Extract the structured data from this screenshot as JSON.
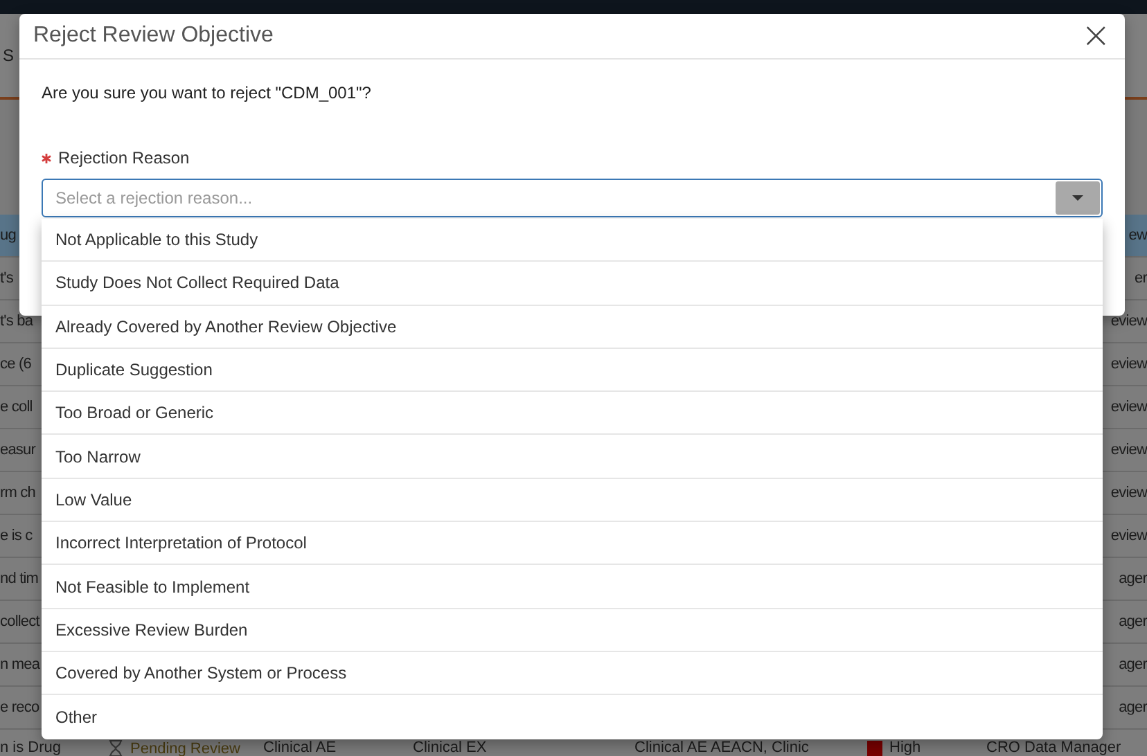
{
  "background": {
    "tab": "S",
    "rows": [
      {
        "cell_1": "ug",
        "cell_2": "ew",
        "selected": true
      },
      {
        "cell_1": "t's",
        "cell_2": "er",
        "selected": false
      },
      {
        "cell_1": "t's ba",
        "cell_2": "eview",
        "selected": false
      },
      {
        "cell_1": "ce (6",
        "cell_2": "eview",
        "selected": false
      },
      {
        "cell_1": "e coll",
        "cell_2": "eview",
        "selected": false
      },
      {
        "cell_1": "easur",
        "cell_2": "eview",
        "selected": false
      },
      {
        "cell_1": "rm ch",
        "cell_2": "eview",
        "selected": false
      },
      {
        "cell_1": "e is c",
        "cell_2": "eview",
        "selected": false
      },
      {
        "cell_1": "nd tim",
        "cell_2": "ager",
        "selected": false
      },
      {
        "cell_1": "collect",
        "cell_2": "ager",
        "selected": false
      },
      {
        "cell_1": "n mea",
        "cell_2": "ager",
        "selected": false
      },
      {
        "cell_1": "e reco",
        "cell_2": "ager",
        "selected": false
      }
    ],
    "last_row": {
      "cell_1": "n is Drug",
      "status": "Pending Review",
      "cell_3": "Clinical AE",
      "cell_4": "Clinical EX",
      "cell_5": "Clinical AE AEACN, Clinic",
      "priority": "High",
      "role": "CRO Data Manager"
    }
  },
  "dialog": {
    "title": "Reject Review Objective",
    "close": "×",
    "message": "Are you sure you want to reject \"CDM_001\"?",
    "field": {
      "label": "Rejection Reason",
      "required": true,
      "placeholder": "Select a rejection reason...",
      "expanded": true,
      "options": [
        "Not Applicable to this Study",
        "Study Does Not Collect Required Data",
        "Already Covered by Another Review Objective",
        "Duplicate Suggestion",
        "Too Broad or Generic",
        "Too Narrow",
        "Low Value",
        "Incorrect Interpretation of Protocol",
        "Not Feasible to Implement",
        "Excessive Review Burden",
        "Covered by Another System or Process",
        "Other"
      ]
    }
  }
}
